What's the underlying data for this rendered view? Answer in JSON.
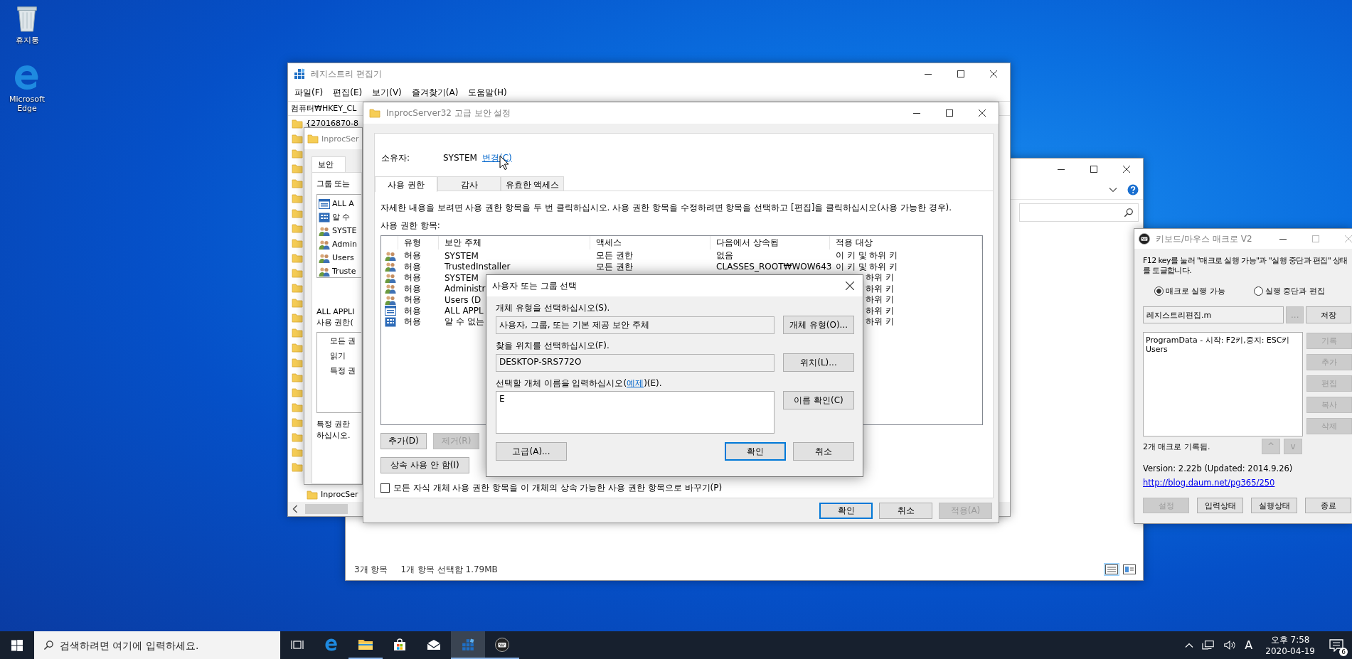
{
  "desktop": {
    "icons": [
      {
        "label": "휴지통",
        "kind": "recycle"
      },
      {
        "label": "Microsoft Edge",
        "kind": "edge"
      }
    ]
  },
  "explorer": {
    "status": [
      "3개 항목",
      "1개 항목 선택함 1.79MB"
    ],
    "view_buttons": [
      {
        "kind": "details",
        "selected": true
      },
      {
        "kind": "tiles",
        "selected": false
      }
    ]
  },
  "registry": {
    "title": "레지스트리 편집기",
    "menu": [
      "파일(F)",
      "편집(E)",
      "보기(V)",
      "즐겨찾기(A)",
      "도움말(H)"
    ],
    "address": "컴퓨터₩HKEY_CL",
    "tree_top": "{27016870-8",
    "tree_child": "InprocSer"
  },
  "permissions": {
    "title": "InprocSer",
    "tab": "보안",
    "group_label": "그룹 또는",
    "principals": [
      {
        "name": "ALL A",
        "kind": "package"
      },
      {
        "name": "알 수",
        "kind": "unknown"
      },
      {
        "name": "SYSTE",
        "kind": "user"
      },
      {
        "name": "Admin",
        "kind": "user"
      },
      {
        "name": "Users",
        "kind": "user"
      },
      {
        "name": "Truste",
        "kind": "user"
      }
    ],
    "perm_label": "ALL APPLI\n사용 권한(",
    "rights": [
      "모든 권",
      "읽기",
      "특정 권"
    ],
    "note": "특정 권한\n하십시오."
  },
  "advanced": {
    "title": "InprocServer32 고급 보안 설정",
    "owner_label": "소유자:",
    "owner": "SYSTEM",
    "change_link": "변경(C)",
    "tabs": [
      {
        "label": "사용 권한",
        "selected": true
      },
      {
        "label": "감사",
        "selected": false
      },
      {
        "label": "유효한 액세스",
        "selected": false
      }
    ],
    "description": "자세한 내용을 보려면 사용 권한 항목을 두 번 클릭하십시오. 사용 권한 항목을 수정하려면 항목을 선택하고 [편집]을 클릭하십시오(사용 가능한 경우).",
    "entries_label": "사용 권한 항목:",
    "columns": [
      "유형",
      "보안 주체",
      "액세스",
      "다음에서 상속됨",
      "적용 대상"
    ],
    "rows": [
      {
        "kind": "user",
        "type": "허용",
        "principal": "SYSTEM",
        "access": "모든 권한",
        "inherited": "없음",
        "applies": "이 키 및 하위 키"
      },
      {
        "kind": "user",
        "type": "허용",
        "principal": "TrustedInstaller",
        "access": "모든 권한",
        "inherited": "CLASSES_ROOT₩WOW643",
        "applies": "이 키 및 하위 키"
      },
      {
        "kind": "user",
        "type": "허용",
        "principal": "SYSTEM",
        "applies": "하위 키"
      },
      {
        "kind": "user",
        "type": "허용",
        "principal": "Administr",
        "applies": "하위 키"
      },
      {
        "kind": "user",
        "type": "허용",
        "principal": "Users (D",
        "applies": "하위 키"
      },
      {
        "kind": "package",
        "type": "허용",
        "principal": "ALL APPL",
        "applies": "하위 키"
      },
      {
        "kind": "unknown",
        "type": "허용",
        "principal": "알 수 없는",
        "applies": "하위 키"
      }
    ],
    "entry_buttons": [
      {
        "label": "추가(D)",
        "disabled": false
      },
      {
        "label": "제거(R)",
        "disabled": true
      }
    ],
    "inherit_button": "상속 사용 안 함(I)",
    "replace_checkbox": {
      "label": "모든 자식 개체 사용 권한 항목을 이 개체의 상속 가능한 사용 권한 항목으로 바꾸기(P)",
      "checked": false
    },
    "footer_buttons": [
      {
        "label": "확인",
        "disabled": false,
        "default": true
      },
      {
        "label": "취소",
        "disabled": false,
        "default": false
      },
      {
        "label": "적용(A)",
        "disabled": true,
        "default": false
      }
    ]
  },
  "select_dialog": {
    "title": "사용자 또는 그룹 선택",
    "object_type_label": "개체 유형을 선택하십시오(S).",
    "object_type": "사용자, 그룹, 또는 기본 제공 보안 주체",
    "object_type_button": "개체 유형(O)...",
    "location_label": "찾을 위치를 선택하십시오(F).",
    "location": "DESKTOP-SRS772O",
    "location_button": "위치(L)...",
    "names_label_before": "선택할 개체 이름을 입력하십시오(",
    "names_label_link": "예제",
    "names_label_after": ")(E).",
    "names": "E",
    "check_button": "이름 확인(C)",
    "advanced_button": "고급(A)...",
    "ok_button": "확인",
    "cancel_button": "취소"
  },
  "macro": {
    "title": "키보드/마우스 매크로 V2",
    "info": "F12 key를 눌러 \"매크로 실행 가능\"과 \"실행 중단과 편집\" 상태\n를 토글합니다.",
    "modes": [
      {
        "label": "매크로 실행 가능",
        "selected": true
      },
      {
        "label": "실행 중단과 편집",
        "selected": false
      }
    ],
    "file": "레지스트리편집.m",
    "browse": {
      "label": "...",
      "disabled": true
    },
    "save": "저장",
    "macros": [
      "ProgramData - 시작: F2키,중지: ESC키",
      "Users"
    ],
    "side_buttons": [
      {
        "label": "기록",
        "disabled": true
      },
      {
        "label": "추가",
        "disabled": true
      },
      {
        "label": "편집",
        "disabled": true
      },
      {
        "label": "복사",
        "disabled": true
      },
      {
        "label": "삭제",
        "disabled": true
      }
    ],
    "count": "2개 매크로 기록됨.",
    "move_buttons": [
      {
        "label": "^",
        "disabled": true
      },
      {
        "label": "v",
        "disabled": true
      }
    ],
    "version": "Version: 2.22b (Updated: 2014.9.26)",
    "link": "http://blog.daum.net/pg365/250",
    "bottom_buttons": [
      {
        "label": "설정",
        "disabled": true
      },
      {
        "label": "입력상태",
        "disabled": false
      },
      {
        "label": "실행상태",
        "disabled": false
      },
      {
        "label": "종료",
        "disabled": false
      }
    ]
  },
  "taskbar": {
    "search_placeholder": "검색하려면 여기에 입력하세요.",
    "apps": [
      {
        "kind": "taskview",
        "running": false,
        "active": false
      },
      {
        "kind": "edge",
        "running": false,
        "active": false
      },
      {
        "kind": "explorer",
        "running": true,
        "active": false
      },
      {
        "kind": "store",
        "running": false,
        "active": false
      },
      {
        "kind": "mail",
        "running": false,
        "active": false
      },
      {
        "kind": "regedit",
        "running": true,
        "active": true
      },
      {
        "kind": "macro",
        "running": true,
        "active": false
      }
    ],
    "ime": "A",
    "time": "오후 7:58",
    "date": "2020-04-19",
    "notifications": "6"
  }
}
